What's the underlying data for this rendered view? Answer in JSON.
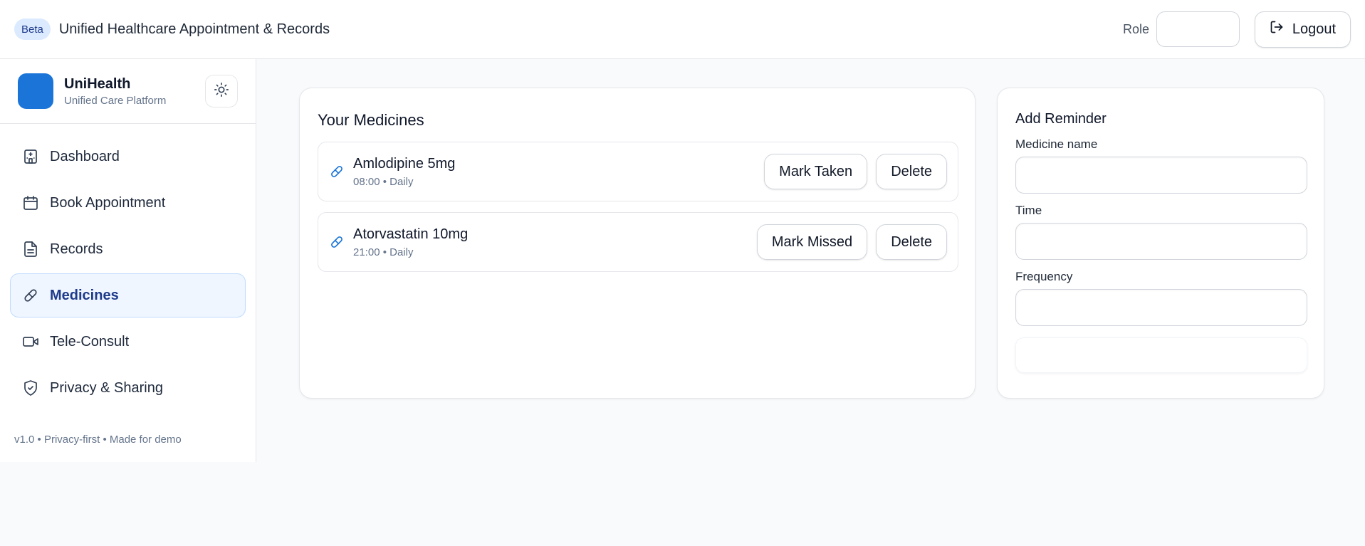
{
  "header": {
    "badge": "Beta",
    "title": "Unified Healthcare Appointment & Records",
    "role_label": "Role",
    "role_value": "",
    "logout_label": "Logout"
  },
  "sidebar": {
    "brand_name": "UniHealth",
    "brand_subtitle": "Unified Care Platform",
    "items": [
      {
        "label": "Dashboard",
        "icon": "hospital-icon"
      },
      {
        "label": "Book Appointment",
        "icon": "calendar-icon"
      },
      {
        "label": "Records",
        "icon": "document-icon"
      },
      {
        "label": "Medicines",
        "icon": "pill-icon",
        "active": true
      },
      {
        "label": "Tele-Consult",
        "icon": "video-icon"
      },
      {
        "label": "Privacy & Sharing",
        "icon": "shield-check-icon"
      }
    ],
    "footer": "v1.0 • Privacy-first • Made for demo"
  },
  "medicines": {
    "title": "Your Medicines",
    "items": [
      {
        "name": "Amlodipine 5mg",
        "meta": "08:00 • Daily",
        "action": "Mark Taken",
        "delete": "Delete"
      },
      {
        "name": "Atorvastatin 10mg",
        "meta": "21:00 • Daily",
        "action": "Mark Missed",
        "delete": "Delete"
      }
    ]
  },
  "reminder": {
    "title": "Add Reminder",
    "medicine_label": "Medicine name",
    "medicine_value": "",
    "time_label": "Time",
    "time_value": "",
    "frequency_label": "Frequency",
    "frequency_value": "",
    "submit_label": ""
  },
  "colors": {
    "accent": "#1b75d8",
    "active_bg": "#eff6ff",
    "background": "#f8fafc"
  }
}
